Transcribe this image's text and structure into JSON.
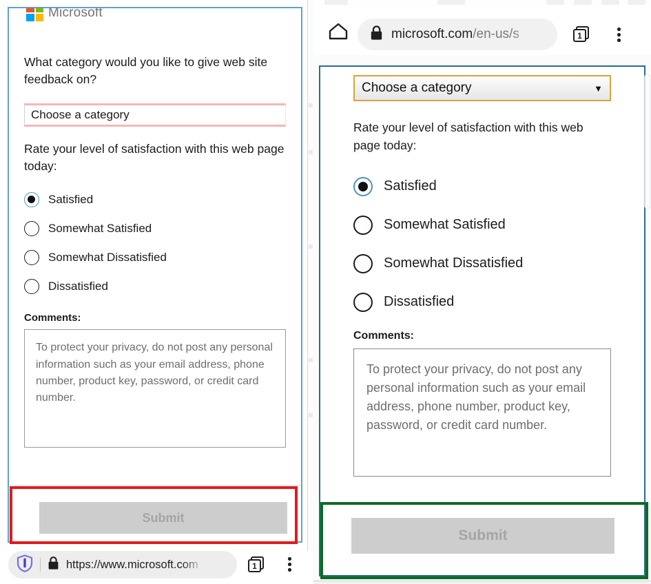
{
  "left_view": {
    "logo": {
      "wordmark": "Microsoft",
      "icon": "microsoft-logo-icon",
      "colors": {
        "red": "#f25022",
        "green": "#7fba00",
        "blue": "#00a4ef",
        "yellow": "#ffb900"
      }
    },
    "question_category": "What category would you like to give web site feedback on?",
    "category_select": {
      "value": "Choose a category",
      "border_highlight": "#f6b5b5"
    },
    "question_rating": "Rate your level of satisfaction with this web page today:",
    "rating_options": [
      {
        "label": "Satisfied",
        "checked": true
      },
      {
        "label": "Somewhat Satisfied",
        "checked": false
      },
      {
        "label": "Somewhat Dissatisfied",
        "checked": false
      },
      {
        "label": "Dissatisfied",
        "checked": false
      }
    ],
    "comments_label": "Comments:",
    "comments_placeholder": "To protect your privacy, do not post any personal information such as your email address, phone number, product key, password, or credit card number.",
    "submit_label": "Submit",
    "card_border_color": "#5da3c4",
    "highlight_color": "#e01b1b"
  },
  "left_browser": {
    "shield_icon": "privacy-shield-icon",
    "lock_icon": "lock-icon",
    "url": "https://www.microsoft.com",
    "tab_count": "1",
    "tab_icon": "tab-switcher-icon",
    "menu_icon": "kebab-menu-icon"
  },
  "right_browser": {
    "home_icon": "home-icon",
    "lock_icon": "lock-icon",
    "url_host": "microsoft.com",
    "url_path": "/en-us/s",
    "tab_count": "1",
    "tab_icon": "tab-switcher-icon",
    "menu_icon": "kebab-menu-icon"
  },
  "right_view": {
    "category_select": {
      "value": "Choose a category",
      "arrow": "▼",
      "border_highlight": "#d9a33c"
    },
    "question_rating": "Rate your level of satisfaction with this web page today:",
    "rating_options": [
      {
        "label": "Satisfied",
        "checked": true
      },
      {
        "label": "Somewhat Satisfied",
        "checked": false
      },
      {
        "label": "Somewhat Dissatisfied",
        "checked": false
      },
      {
        "label": "Dissatisfied",
        "checked": false
      }
    ],
    "comments_label": "Comments:",
    "comments_placeholder": "To protect your privacy, do not post any personal information such as your email address, phone number, product key, password, or credit card number.",
    "submit_label": "Submit",
    "card_border_color": "#2a6c8c",
    "highlight_color": "#0c6b22"
  }
}
